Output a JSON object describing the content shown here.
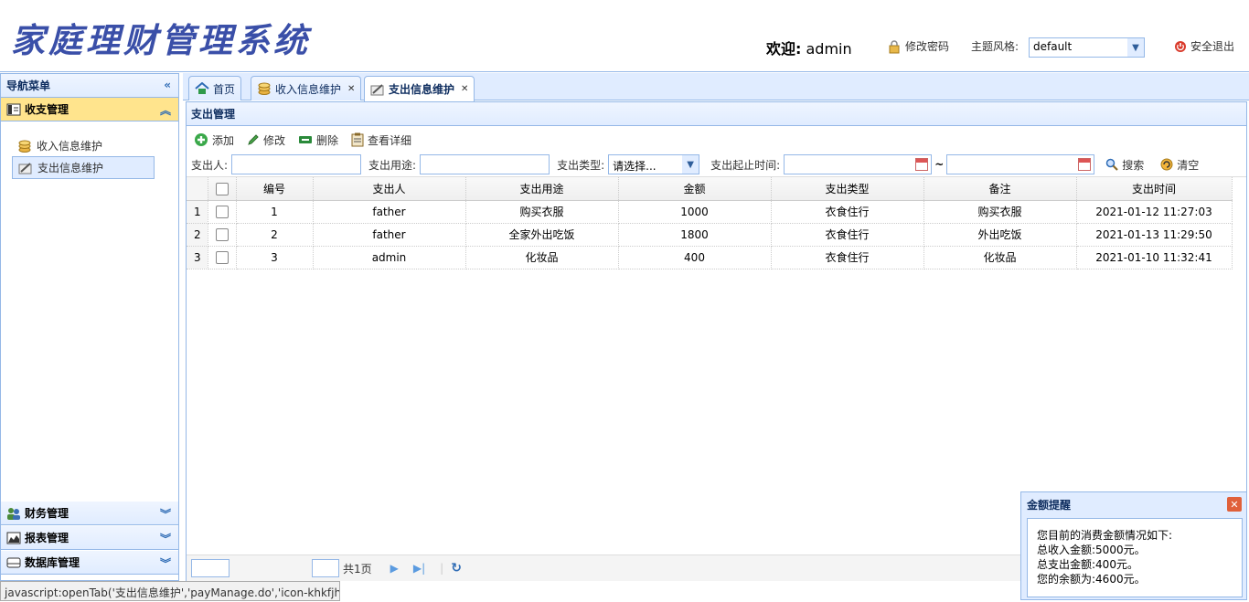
{
  "header": {
    "logo_text": "家庭理财管理系统",
    "welcome_label": "欢迎:",
    "username": "admin",
    "change_password": "修改密码",
    "theme_label": "主题风格:",
    "theme_value": "default",
    "logout": "安全退出"
  },
  "sidebar": {
    "title": "导航菜单",
    "sections": [
      {
        "label": "收支管理",
        "items": [
          {
            "label": "收入信息维护"
          },
          {
            "label": "支出信息维护"
          }
        ]
      },
      {
        "label": "财务管理"
      },
      {
        "label": "报表管理"
      },
      {
        "label": "数据库管理"
      }
    ]
  },
  "tabs": [
    {
      "label": "首页"
    },
    {
      "label": "收入信息维护"
    },
    {
      "label": "支出信息维护"
    }
  ],
  "panel": {
    "title": "支出管理"
  },
  "toolbar": {
    "add": "添加",
    "edit": "修改",
    "delete": "删除",
    "view": "查看详细"
  },
  "search": {
    "payer_label": "支出人:",
    "purpose_label": "支出用途:",
    "type_label": "支出类型:",
    "type_value": "请选择...",
    "date_label": "支出起止时间:",
    "date_sep": "~",
    "search_btn": "搜索",
    "clear_btn": "清空"
  },
  "grid": {
    "columns": [
      "编号",
      "支出人",
      "支出用途",
      "金额",
      "支出类型",
      "备注",
      "支出时间"
    ],
    "rows": [
      {
        "rn": "1",
        "id": "1",
        "payer": "father",
        "purpose": "购买衣服",
        "amount": "1000",
        "type": "衣食住行",
        "note": "购买衣服",
        "time": "2021-01-12 11:27:03"
      },
      {
        "rn": "2",
        "id": "2",
        "payer": "father",
        "purpose": "全家外出吃饭",
        "amount": "1800",
        "type": "衣食住行",
        "note": "外出吃饭",
        "time": "2021-01-13 11:29:50"
      },
      {
        "rn": "3",
        "id": "3",
        "payer": "admin",
        "purpose": "化妆品",
        "amount": "400",
        "type": "衣食住行",
        "note": "化妆品",
        "time": "2021-01-10 11:32:41"
      }
    ]
  },
  "pager": {
    "total_pages": "共1页"
  },
  "statusbar": {
    "text": "javascript:openTab('支出信息维护','payManage.do','icon-khkfjh')"
  },
  "notice": {
    "title": "金额提醒",
    "lines": [
      "您目前的消费金额情况如下:",
      "总收入金额:5000元。",
      "总支出金额:400元。",
      "您的余额为:4600元。"
    ]
  }
}
